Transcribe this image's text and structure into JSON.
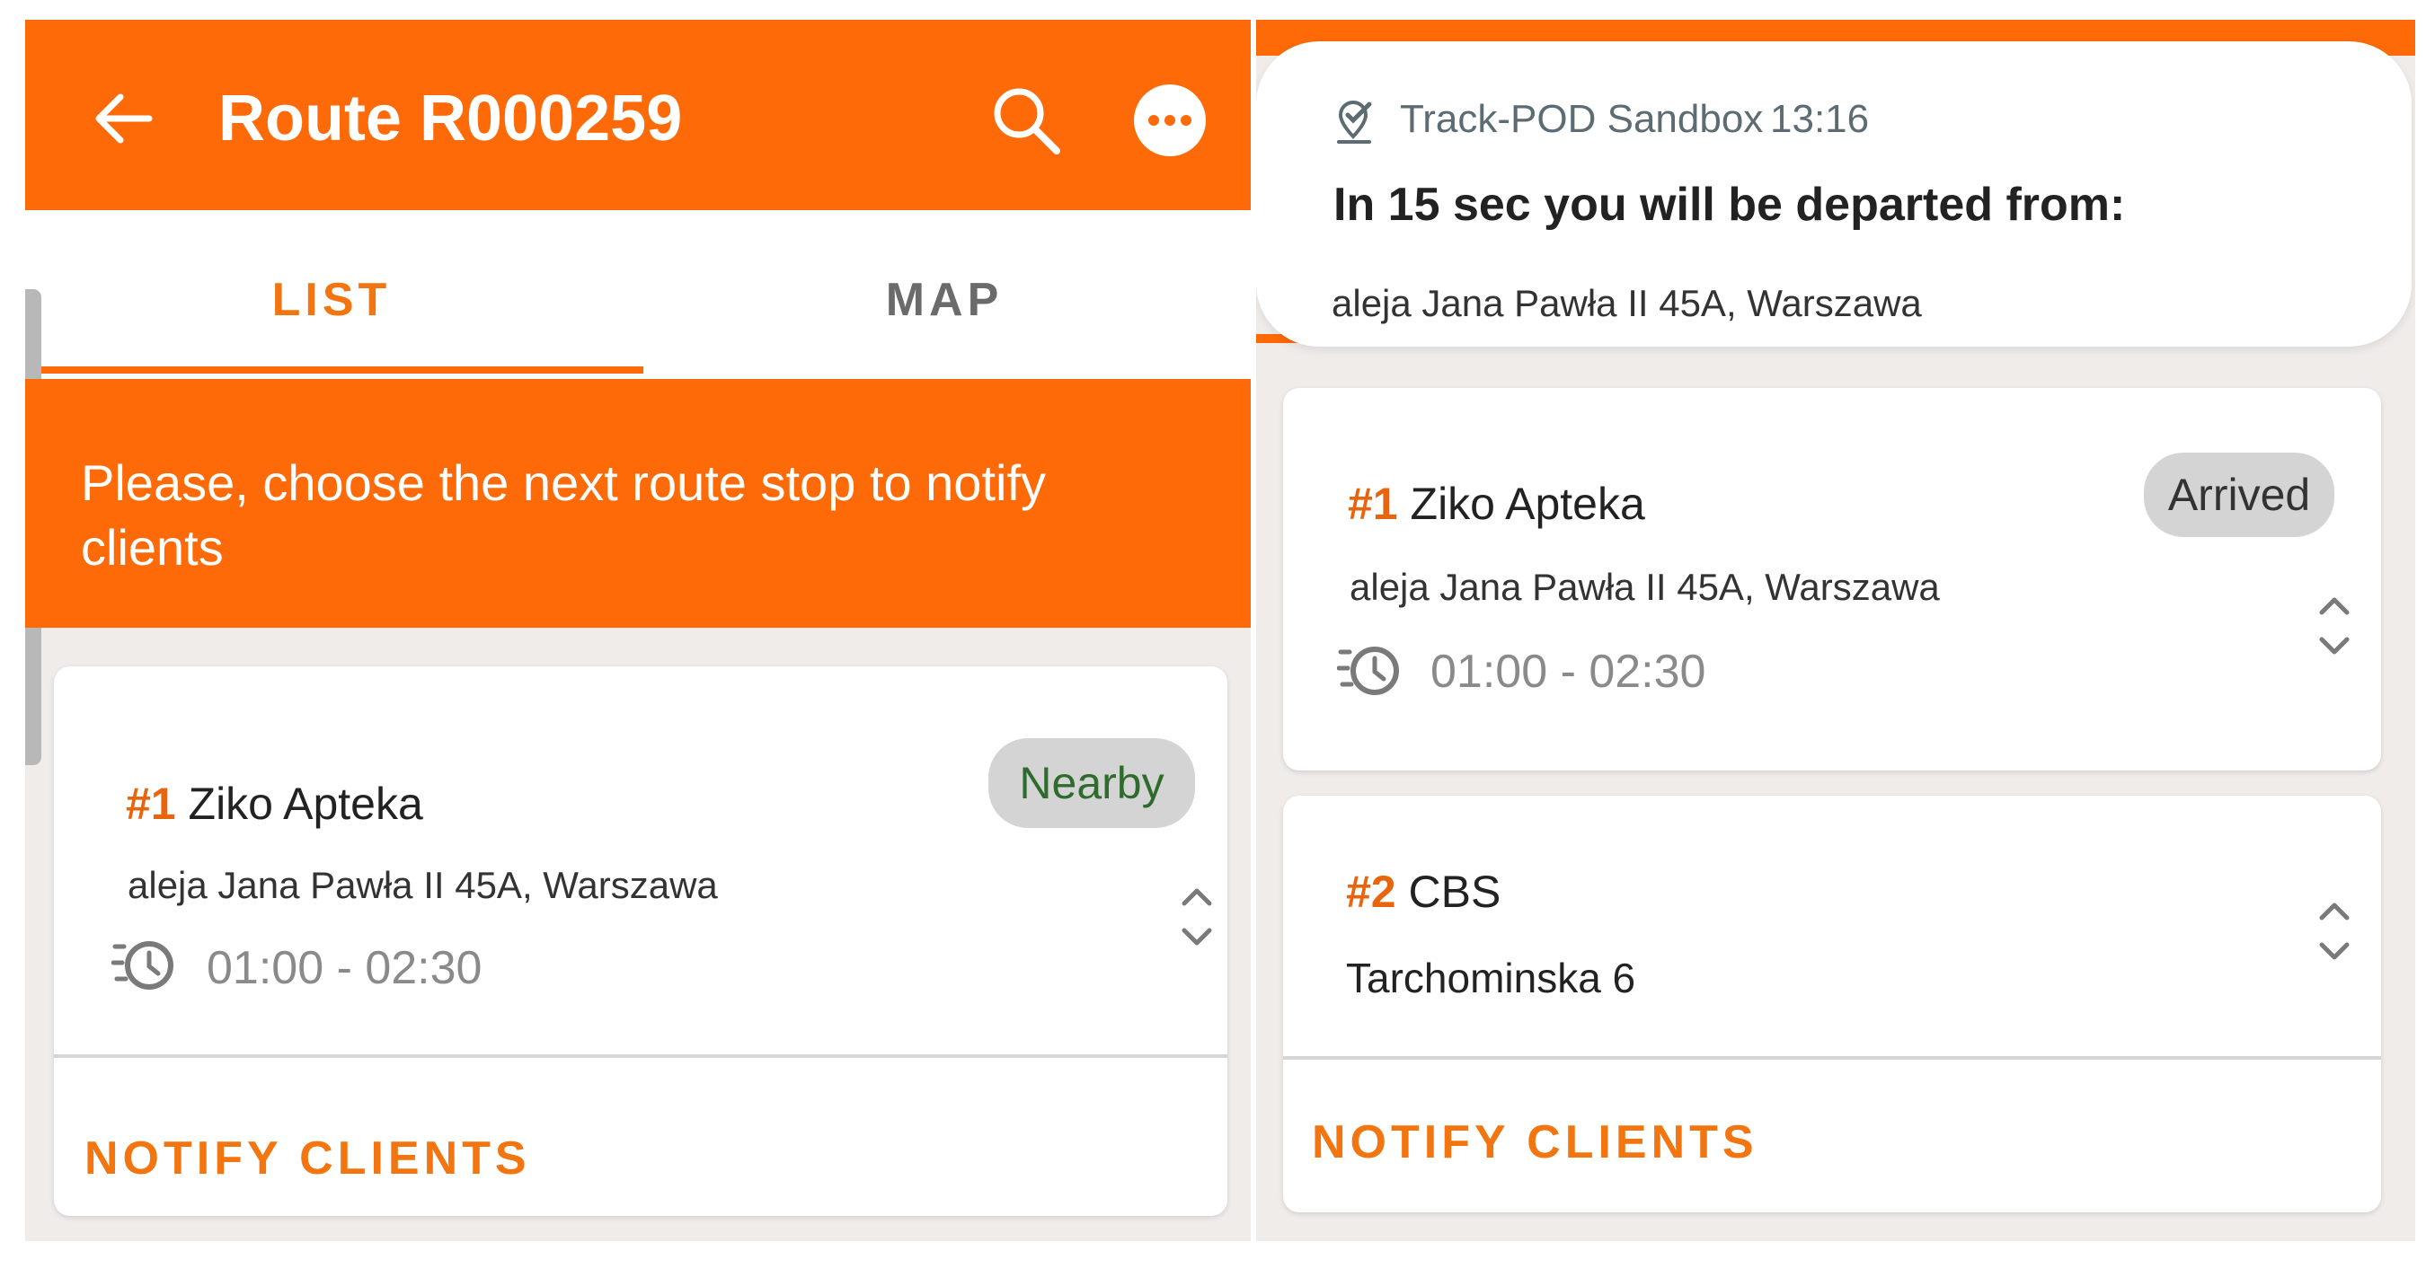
{
  "left": {
    "header": {
      "title": "Route R000259"
    },
    "tabs": [
      {
        "label": "LIST"
      },
      {
        "label": "MAP"
      }
    ],
    "banner": {
      "message": "Please, choose the next route stop to notify clients"
    },
    "stop": {
      "number": "#1",
      "name": "Ziko Apteka",
      "address": "aleja Jana Pawła II 45A, Warszawa",
      "time_window": "01:00 - 02:30",
      "status": "Nearby",
      "action_label": "NOTIFY CLIENTS"
    }
  },
  "right": {
    "notification": {
      "app_name": "Track-POD Sandbox",
      "time": "13:16",
      "title": "In 15 sec you will be departed from:",
      "body": "aleja Jana Pawła II 45A, Warszawa"
    },
    "stops": [
      {
        "number": "#1",
        "name": "Ziko Apteka",
        "address": "aleja Jana Pawła II 45A, Warszawa",
        "time_window": "01:00 - 02:30",
        "status": "Arrived"
      },
      {
        "number": "#2",
        "name": "CBS",
        "address": "Tarchominska 6"
      }
    ],
    "action_label": "NOTIFY CLIENTS"
  },
  "colors": {
    "brand_orange": "#fe6a07",
    "accent_text_orange": "#f2750f",
    "nearby_text": "#2f6b2f",
    "badge_bg": "#d4d4d4"
  },
  "icons": [
    "back-arrow-icon",
    "search-icon",
    "more-options-icon",
    "clock-icon",
    "chevron-up-down-icon",
    "track-pod-app-icon"
  ]
}
